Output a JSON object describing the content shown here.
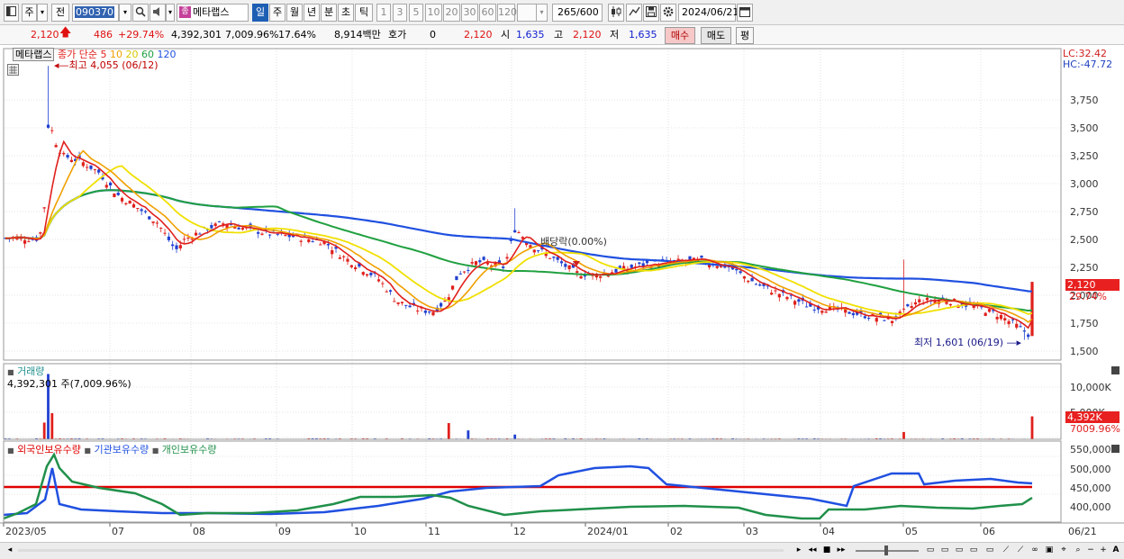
{
  "toolbar": {
    "market": "주",
    "period_all": "전",
    "code": "090370",
    "stock_name": "메타랩스",
    "stock_badge": "종",
    "periods": [
      "일",
      "주",
      "월",
      "년",
      "분",
      "초",
      "틱"
    ],
    "active_period": "일",
    "intervals": [
      "1",
      "3",
      "5",
      "10",
      "20",
      "30",
      "60",
      "120"
    ],
    "count_value": "265",
    "count_total": "/600",
    "date": "2024/06/21"
  },
  "quote": {
    "price": "2,120",
    "change": "486",
    "change_pct": "+29.74%",
    "volume": "4,392,301",
    "volume_pct": "7,009.96%",
    "turnover": "17.64%",
    "amount": "8,914백만",
    "hoga_label": "호가",
    "hoga_value": "0",
    "hoga_price": "2,120",
    "open_label": "시",
    "open": "1,635",
    "high_label": "고",
    "high": "2,120",
    "low_label": "저",
    "low": "1,635",
    "buy_label": "매수",
    "sell_label": "매도",
    "flat_label": "평"
  },
  "price_panel": {
    "name_tag": "메타랩스",
    "ma_label": "종가 단순",
    "ma_periods": [
      {
        "label": "5",
        "color": "#e0201c"
      },
      {
        "label": "10",
        "color": "#f0a000"
      },
      {
        "label": "20",
        "color": "#f0e000"
      },
      {
        "label": "60",
        "color": "#20a040"
      },
      {
        "label": "120",
        "color": "#2050e0"
      }
    ],
    "high_note": "최고 4,055 (06/12)",
    "low_note": "최저 1,601 (06/19)",
    "dividend_note": "배당락(0.00%)",
    "lc": "LC:32.42",
    "hc": "HC:-47.72",
    "y_ticks": [
      "3,750",
      "3,500",
      "3,250",
      "3,000",
      "2,750",
      "2,500",
      "2,250",
      "2,000",
      "1,750",
      "1,500"
    ],
    "current_price_tag": "2,120",
    "current_pct_tag": "29.74%"
  },
  "volume_panel": {
    "title": "거래량",
    "info": "4,392,301 주(7,009.96%)",
    "y_ticks": [
      "10,000K",
      "5,000K"
    ],
    "current_tag": "4,392K",
    "current_pct": "7009.96%"
  },
  "holding_panel": {
    "series": [
      {
        "name": "외국인보유수량",
        "color": "#e00000"
      },
      {
        "name": "기관보유수량",
        "color": "#2050e0"
      },
      {
        "name": "개인보유수량",
        "color": "#20904a"
      }
    ],
    "y_ticks": [
      "550,000",
      "500,000",
      "450,000",
      "400,000"
    ]
  },
  "x_axis": {
    "ticks": [
      "2023/05",
      "07",
      "08",
      "09",
      "10",
      "11",
      "12",
      "2024/01",
      "02",
      "03",
      "04",
      "05",
      "06"
    ],
    "right_label": "06/21"
  },
  "colors": {
    "up": "#e0201c",
    "down": "#2040d0",
    "ma5": "#e0201c",
    "ma10": "#f0a000",
    "ma20": "#f0e000",
    "ma60": "#20a040",
    "ma120": "#2050e0"
  }
}
